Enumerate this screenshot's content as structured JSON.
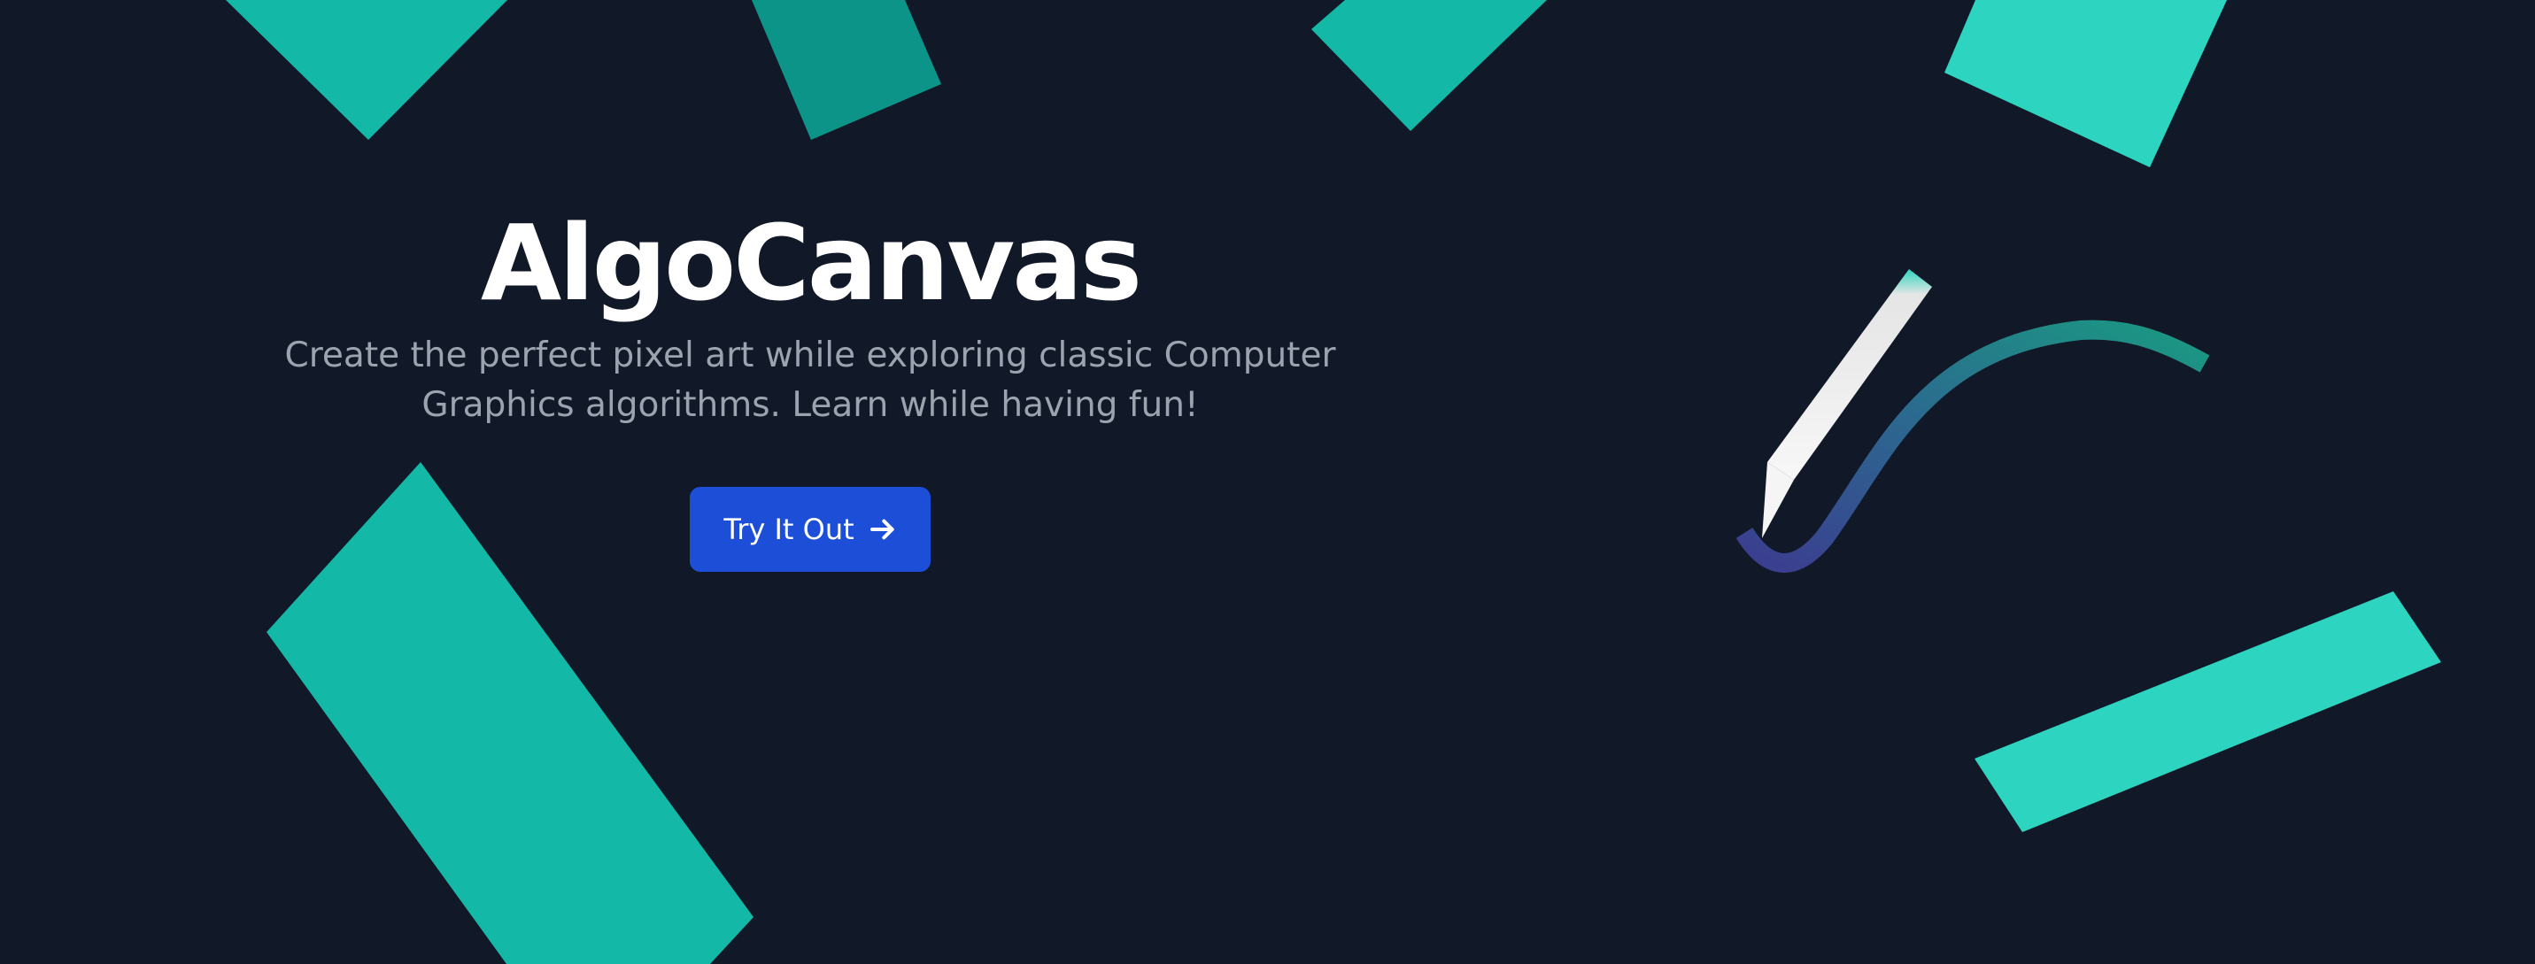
{
  "hero": {
    "title": "AlgoCanvas",
    "subtitle": "Create the perfect pixel art while exploring classic Computer Graphics algorithms. Learn while having fun!",
    "cta_label": "Try It Out"
  },
  "icons": {
    "cta": "arrow-right-icon",
    "illustration": "pencil-drawing-icon"
  },
  "colors": {
    "background": "#111827",
    "shape_primary": "#14b8a6",
    "shape_dark": "#0d9488",
    "shape_light": "#2dd4bf",
    "button": "#1d4ed8",
    "subtitle": "#9ca3af"
  }
}
